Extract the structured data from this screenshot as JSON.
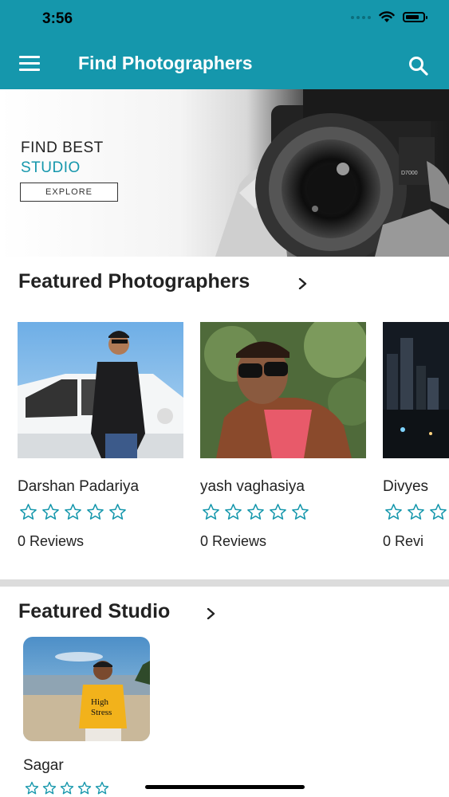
{
  "status_bar": {
    "time": "3:56"
  },
  "app_bar": {
    "title": "Find Photographers"
  },
  "banner": {
    "line1": "FIND BEST",
    "line2": "STUDIO",
    "button_label": "EXPLORE",
    "camera_model": "D7000"
  },
  "featured_photographers": {
    "heading": "Featured Photographers",
    "items": [
      {
        "name": "Darshan Padariya",
        "reviews": "0 Reviews",
        "rating": 0
      },
      {
        "name": "yash vaghasiya",
        "reviews": "0 Reviews",
        "rating": 0
      },
      {
        "name": "Divyes",
        "reviews": "0 Revi",
        "rating": 0
      }
    ]
  },
  "featured_studio": {
    "heading": "Featured Studio",
    "items": [
      {
        "name": "Sagar",
        "rating": 0
      }
    ]
  },
  "colors": {
    "accent": "#1597ac",
    "star": "#1597ac"
  }
}
